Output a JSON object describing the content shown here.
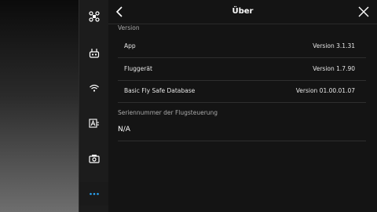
{
  "header": {
    "title": "Über"
  },
  "sidebar": {
    "items": [
      {
        "icon": "aircraft-icon"
      },
      {
        "icon": "remote-controller-icon"
      },
      {
        "icon": "wifi-signal-icon"
      },
      {
        "icon": "video-transmission-icon"
      },
      {
        "icon": "camera-icon"
      },
      {
        "icon": "more-icon",
        "active": true
      }
    ]
  },
  "version_section": {
    "label": "Version",
    "rows": [
      {
        "name": "App",
        "value": "Version 3.1.31"
      },
      {
        "name": "Fluggerät",
        "value": "Version 1.7.90"
      },
      {
        "name": "Basic Fly Safe Database",
        "value": "Version 01.00.01.07"
      }
    ]
  },
  "serial_section": {
    "label": "Seriennummer der Flugsteuerung",
    "value": "N/A"
  },
  "colors": {
    "accent": "#2aa4f4",
    "panel_bg": "#141414"
  }
}
